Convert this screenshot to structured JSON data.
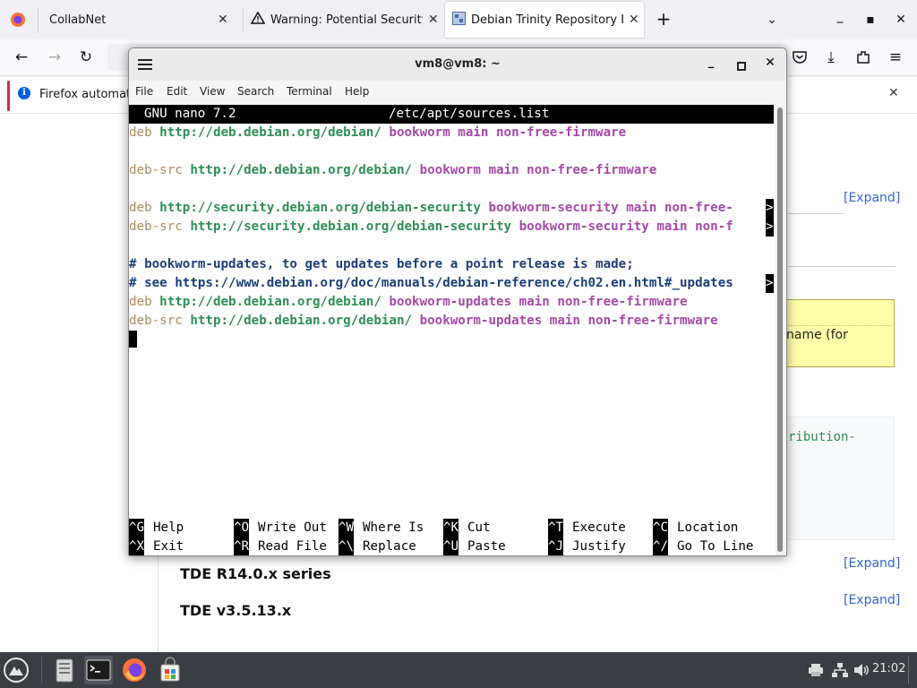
{
  "browser": {
    "tabs": [
      {
        "title": "CollabNet"
      },
      {
        "title": "Warning: Potential Security R"
      },
      {
        "title": "Debian Trinity Repository Inst"
      }
    ],
    "new_tab_symbol": "+",
    "window_controls": {
      "list": "⌄",
      "minimize": "_",
      "maximize": "▪",
      "close": "✕"
    },
    "notification": {
      "text": "Firefox automatic"
    }
  },
  "webpage": {
    "expand_label": "[Expand]",
    "partial_yellow_text": "name (for",
    "partial_green_text": "ribution-",
    "sections": [
      "TDE R14.0.x series",
      "TDE v3.5.13.x"
    ]
  },
  "terminal": {
    "title": "vm8@vm8: ~",
    "menu": [
      "File",
      "Edit",
      "View",
      "Search",
      "Terminal",
      "Help"
    ],
    "nano_header": {
      "app": "GNU nano 7.2",
      "file": "/etc/apt/sources.list"
    },
    "lines": [
      {
        "kw": "deb ",
        "url": "http://deb.debian.org/debian/",
        "suite": " bookworm main non-free-firmware"
      },
      {
        "kw": "deb-src ",
        "url": "http://deb.debian.org/debian/",
        "suite": " bookworm main non-free-firmware"
      },
      {
        "kw": "deb ",
        "url": "http://security.debian.org/debian-security",
        "suite": " bookworm-security main non-free-",
        "trunc": ">"
      },
      {
        "kw": "deb-src ",
        "url": "http://security.debian.org/debian-security",
        "suite": " bookworm-security main non-f",
        "trunc": ">"
      },
      {
        "comment": "# bookworm-updates, to get updates before a point release is made;"
      },
      {
        "comment": "# see https://www.debian.org/doc/manuals/debian-reference/ch02.en.html#_updates",
        "trunc": ">"
      },
      {
        "kw": "deb ",
        "url": "http://deb.debian.org/debian/",
        "suite": " bookworm-updates main non-free-firmware"
      },
      {
        "kw": "deb-src ",
        "url": "http://deb.debian.org/debian/",
        "suite": " bookworm-updates main non-free-firmware"
      }
    ],
    "shortcuts": [
      [
        {
          "key": "^G",
          "label": "Help"
        },
        {
          "key": "^O",
          "label": "Write Out"
        },
        {
          "key": "^W",
          "label": "Where Is"
        },
        {
          "key": "^K",
          "label": "Cut"
        },
        {
          "key": "^T",
          "label": "Execute"
        },
        {
          "key": "^C",
          "label": "Location"
        }
      ],
      [
        {
          "key": "^X",
          "label": "Exit"
        },
        {
          "key": "^R",
          "label": "Read File"
        },
        {
          "key": "^\\",
          "label": "Replace"
        },
        {
          "key": "^U",
          "label": "Paste"
        },
        {
          "key": "^J",
          "label": "Justify"
        },
        {
          "key": "^/",
          "label": "Go To Line"
        }
      ]
    ]
  },
  "taskbar": {
    "clock": "21:02",
    "icons": [
      "menu-icon",
      "file-manager-icon",
      "terminal-icon",
      "firefox-icon",
      "software-store-icon"
    ]
  },
  "colors": {
    "nano_keyword": "#b08a5f",
    "nano_url": "#2f8f56",
    "nano_suite": "#a64aa8",
    "nano_comment": "#1b3f78",
    "link": "#3366cc"
  }
}
